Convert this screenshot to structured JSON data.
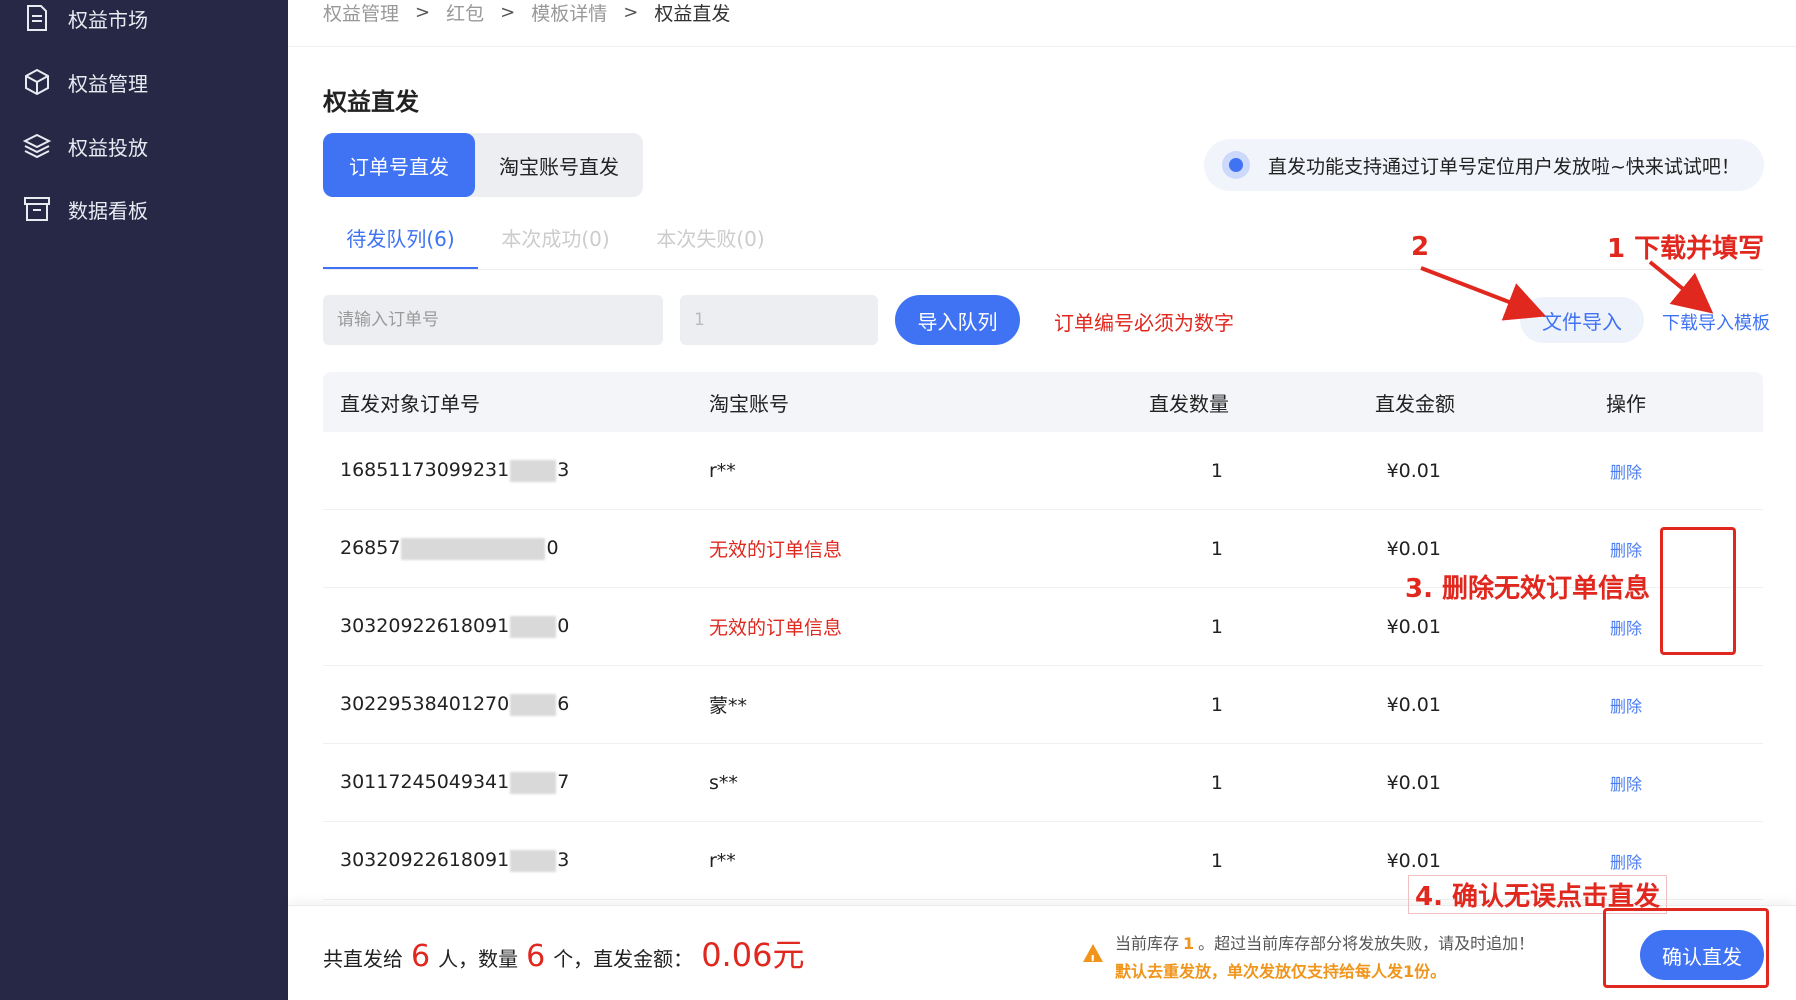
{
  "sidebar": {
    "items": [
      {
        "label": "权益市场",
        "icon": "document-icon"
      },
      {
        "label": "权益管理",
        "icon": "box-icon"
      },
      {
        "label": "权益投放",
        "icon": "layers-icon"
      },
      {
        "label": "数据看板",
        "icon": "archive-icon"
      }
    ]
  },
  "breadcrumb": [
    "权益管理",
    "红包",
    "模板详情",
    "权益直发"
  ],
  "page_title": "权益直发",
  "mode_tabs": [
    "订单号直发",
    "淘宝账号直发"
  ],
  "tip": "直发功能支持通过订单号定位用户发放啦~快来试试吧！",
  "subtabs": [
    "待发队列(6)",
    "本次成功(0)",
    "本次失败(0)"
  ],
  "form": {
    "order_placeholder": "请输入订单号",
    "qty_placeholder": "1",
    "import_queue_label": "导入队列",
    "hint": "订单编号必须为数字",
    "file_import_label": "文件导入",
    "template_link_label": "下载导入模板"
  },
  "table": {
    "headers": [
      "直发对象订单号",
      "淘宝账号",
      "直发数量",
      "直发金额",
      "操作"
    ],
    "rows": [
      {
        "order_prefix": "16851173099231",
        "order_suffix": "3",
        "account": "r**",
        "qty": "1",
        "amount": "¥0.01",
        "action": "删除",
        "invalid": false
      },
      {
        "order_prefix": "26857",
        "order_suffix": "0",
        "account": "无效的订单信息",
        "qty": "1",
        "amount": "¥0.01",
        "action": "删除",
        "invalid": true
      },
      {
        "order_prefix": "30320922618091",
        "order_suffix": "0",
        "account": "无效的订单信息",
        "qty": "1",
        "amount": "¥0.01",
        "action": "删除",
        "invalid": true
      },
      {
        "order_prefix": "30229538401270",
        "order_suffix": "6",
        "account": "蒙**",
        "qty": "1",
        "amount": "¥0.01",
        "action": "删除",
        "invalid": false
      },
      {
        "order_prefix": "30117245049341",
        "order_suffix": "7",
        "account": "s**",
        "qty": "1",
        "amount": "¥0.01",
        "action": "删除",
        "invalid": false
      },
      {
        "order_prefix": "30320922618091",
        "order_suffix": "3",
        "account": "r**",
        "qty": "1",
        "amount": "¥0.01",
        "action": "删除",
        "invalid": false
      }
    ]
  },
  "footer": {
    "sum_prefix": "共直发给",
    "people": "6",
    "people_unit": "人，数量",
    "count": "6",
    "count_unit": "个，直发金额：",
    "money": "0.06元",
    "warn_line1_a": "当前库存",
    "stock": "1",
    "warn_line1_b": "。超过当前库存部分将发放失败，请及时追加！",
    "warn_line2": "默认去重发放，单次发放仅支持给每人发1份。",
    "confirm_label": "确认直发"
  },
  "annotations": {
    "a1": "1 下载并填写",
    "a2": "2",
    "a3": "3. 删除无效订单信息",
    "a4": "4. 确认无误点击直发"
  },
  "colors": {
    "primary": "#3f73f4",
    "danger": "#e0281f",
    "sidebar": "#262845",
    "warning": "#f0951c"
  }
}
